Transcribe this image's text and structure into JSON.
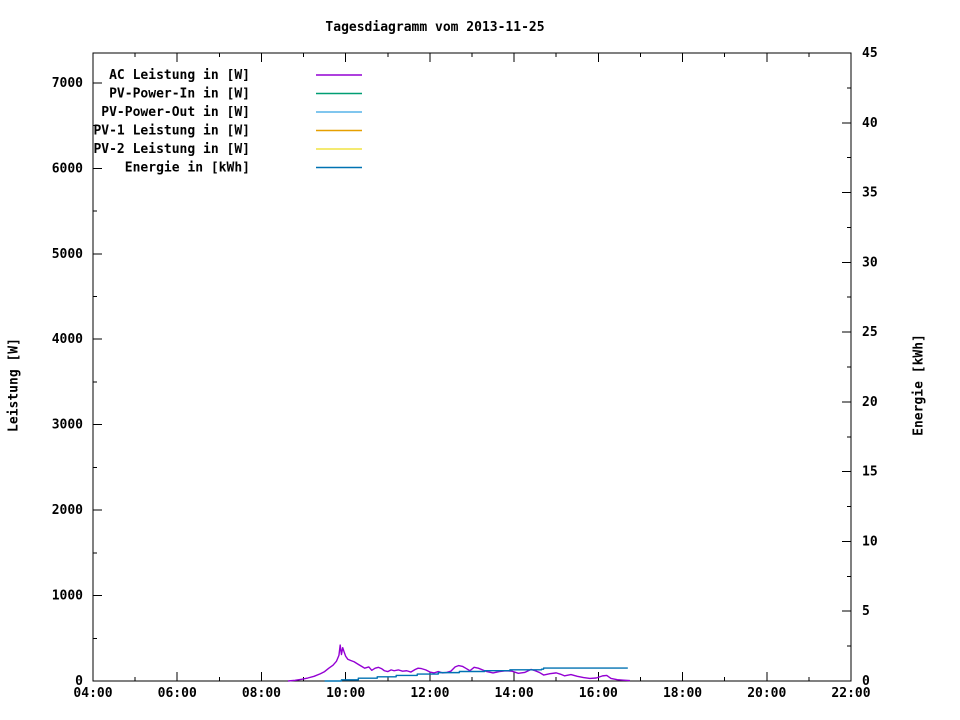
{
  "title": "Tagesdiagramm vom 2013-11-25",
  "axes": {
    "x": {
      "tick_labels": [
        "04:00",
        "06:00",
        "08:00",
        "10:00",
        "12:00",
        "14:00",
        "16:00",
        "18:00",
        "20:00",
        "22:00"
      ],
      "major_hours": [
        4,
        6,
        8,
        10,
        12,
        14,
        16,
        18,
        20,
        22
      ],
      "range_hours": [
        4,
        22
      ],
      "minor_every_hours": 1
    },
    "y_left": {
      "label": "Leistung [W]",
      "tick_labels": [
        "0",
        "1000",
        "2000",
        "3000",
        "4000",
        "5000",
        "6000",
        "7000"
      ],
      "tick_values": [
        0,
        1000,
        2000,
        3000,
        4000,
        5000,
        6000,
        7000
      ],
      "minor_step": 500,
      "range": [
        0,
        7350
      ]
    },
    "y_right": {
      "label": "Energie [kWh]",
      "tick_labels": [
        "0",
        "5",
        "10",
        "15",
        "20",
        "25",
        "30",
        "35",
        "40",
        "45"
      ],
      "tick_values": [
        0,
        5,
        10,
        15,
        20,
        25,
        30,
        35,
        40,
        45
      ],
      "minor_step": 2.5,
      "range": [
        0,
        45
      ]
    }
  },
  "legend": {
    "items": [
      {
        "label": "AC Leistung in [W]",
        "color": "#9400d3"
      },
      {
        "label": "PV-Power-In in [W]",
        "color": "#009e73"
      },
      {
        "label": "PV-Power-Out in [W]",
        "color": "#56b4e9"
      },
      {
        "label": "PV-1 Leistung in [W]",
        "color": "#e69f00"
      },
      {
        "label": "PV-2 Leistung in [W]",
        "color": "#f0e442"
      },
      {
        "label": "Energie in [kWh]",
        "color": "#0072b2"
      }
    ]
  },
  "chart_data": {
    "type": "line",
    "title": "Tagesdiagramm vom 2013-11-25",
    "xlabel": "",
    "x_unit": "time of day (decimal hours)",
    "x_range": [
      4,
      22
    ],
    "ylabel_left": "Leistung [W]",
    "ylim_left": [
      0,
      7350
    ],
    "ylabel_right": "Energie [kWh]",
    "ylim_right": [
      0,
      45
    ],
    "grid": false,
    "legend_position": "top-left-inside",
    "series": [
      {
        "name": "AC Leistung in [W]",
        "color": "#9400d3",
        "axis": "left",
        "step": false,
        "visible_in_plot": true,
        "points": [
          [
            8.63,
            0
          ],
          [
            8.8,
            8
          ],
          [
            8.95,
            20
          ],
          [
            9.1,
            35
          ],
          [
            9.25,
            55
          ],
          [
            9.4,
            85
          ],
          [
            9.5,
            110
          ],
          [
            9.6,
            150
          ],
          [
            9.7,
            185
          ],
          [
            9.78,
            230
          ],
          [
            9.84,
            300
          ],
          [
            9.87,
            420
          ],
          [
            9.9,
            310
          ],
          [
            9.93,
            390
          ],
          [
            9.97,
            330
          ],
          [
            10.0,
            290
          ],
          [
            10.05,
            255
          ],
          [
            10.12,
            240
          ],
          [
            10.2,
            225
          ],
          [
            10.3,
            195
          ],
          [
            10.4,
            165
          ],
          [
            10.45,
            150
          ],
          [
            10.55,
            165
          ],
          [
            10.62,
            125
          ],
          [
            10.7,
            150
          ],
          [
            10.78,
            160
          ],
          [
            10.85,
            145
          ],
          [
            10.92,
            120
          ],
          [
            11.0,
            110
          ],
          [
            11.08,
            130
          ],
          [
            11.15,
            120
          ],
          [
            11.25,
            130
          ],
          [
            11.35,
            115
          ],
          [
            11.45,
            120
          ],
          [
            11.55,
            105
          ],
          [
            11.65,
            135
          ],
          [
            11.72,
            150
          ],
          [
            11.8,
            145
          ],
          [
            11.9,
            130
          ],
          [
            12.0,
            105
          ],
          [
            12.1,
            95
          ],
          [
            12.2,
            110
          ],
          [
            12.3,
            95
          ],
          [
            12.4,
            100
          ],
          [
            12.5,
            115
          ],
          [
            12.6,
            165
          ],
          [
            12.68,
            180
          ],
          [
            12.78,
            170
          ],
          [
            12.85,
            150
          ],
          [
            12.95,
            120
          ],
          [
            13.05,
            160
          ],
          [
            13.15,
            150
          ],
          [
            13.25,
            130
          ],
          [
            13.35,
            110
          ],
          [
            13.5,
            95
          ],
          [
            13.65,
            110
          ],
          [
            13.8,
            120
          ],
          [
            13.95,
            115
          ],
          [
            14.1,
            90
          ],
          [
            14.25,
            100
          ],
          [
            14.4,
            135
          ],
          [
            14.5,
            120
          ],
          [
            14.6,
            100
          ],
          [
            14.7,
            70
          ],
          [
            14.85,
            85
          ],
          [
            15.0,
            95
          ],
          [
            15.1,
            80
          ],
          [
            15.2,
            60
          ],
          [
            15.35,
            75
          ],
          [
            15.5,
            55
          ],
          [
            15.65,
            40
          ],
          [
            15.8,
            30
          ],
          [
            15.95,
            35
          ],
          [
            16.1,
            60
          ],
          [
            16.2,
            65
          ],
          [
            16.3,
            30
          ],
          [
            16.45,
            15
          ],
          [
            16.6,
            10
          ],
          [
            16.75,
            5
          ]
        ]
      },
      {
        "name": "PV-Power-In in [W]",
        "color": "#009e73",
        "axis": "left",
        "step": false,
        "visible_in_plot": false,
        "points": []
      },
      {
        "name": "PV-Power-Out in [W]",
        "color": "#56b4e9",
        "axis": "left",
        "step": false,
        "visible_in_plot": false,
        "points": []
      },
      {
        "name": "PV-1 Leistung in [W]",
        "color": "#e69f00",
        "axis": "left",
        "step": false,
        "visible_in_plot": false,
        "points": []
      },
      {
        "name": "PV-2 Leistung in [W]",
        "color": "#f0e442",
        "axis": "left",
        "step": false,
        "visible_in_plot": false,
        "points": []
      },
      {
        "name": "Energie in [kWh]",
        "color": "#0072b2",
        "axis": "right",
        "step": true,
        "visible_in_plot": true,
        "points": [
          [
            9.5,
            0
          ],
          [
            9.9,
            0.08
          ],
          [
            10.3,
            0.2
          ],
          [
            10.75,
            0.3
          ],
          [
            11.2,
            0.4
          ],
          [
            11.7,
            0.5
          ],
          [
            12.2,
            0.6
          ],
          [
            12.7,
            0.68
          ],
          [
            13.3,
            0.74
          ],
          [
            13.9,
            0.8
          ],
          [
            14.65,
            0.85
          ],
          [
            14.7,
            0.93
          ],
          [
            16.7,
            0.93
          ]
        ]
      }
    ]
  }
}
